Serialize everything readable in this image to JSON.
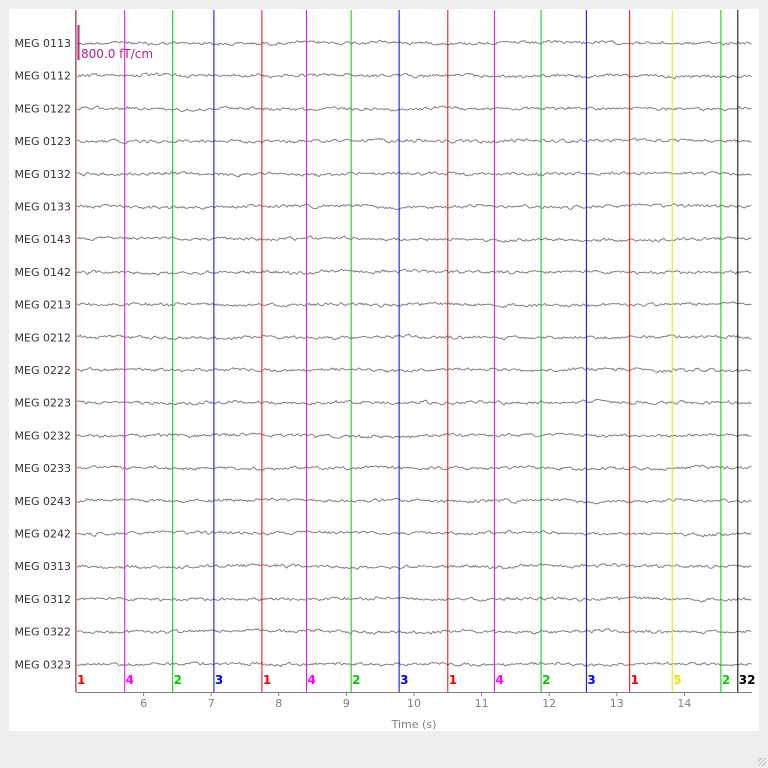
{
  "chart_data": {
    "type": "line",
    "xlabel": "Time (s)",
    "xlim": [
      5.0,
      15.0
    ],
    "x_ticks": [
      6,
      7,
      8,
      9,
      10,
      11,
      12,
      13,
      14
    ],
    "channels": [
      "MEG 0113",
      "MEG 0112",
      "MEG 0122",
      "MEG 0123",
      "MEG 0132",
      "MEG 0133",
      "MEG 0143",
      "MEG 0142",
      "MEG 0213",
      "MEG 0212",
      "MEG 0222",
      "MEG 0223",
      "MEG 0232",
      "MEG 0233",
      "MEG 0243",
      "MEG 0242",
      "MEG 0313",
      "MEG 0312",
      "MEG 0322",
      "MEG 0323"
    ],
    "trace_color": "#808080",
    "scale_bar": {
      "label": "800.0 fT/cm",
      "color": "#b5247e"
    },
    "events": [
      {
        "t": 5.0,
        "id": "1",
        "color": "#ff0000"
      },
      {
        "t": 5.72,
        "id": "4",
        "color": "#ff00ff"
      },
      {
        "t": 6.43,
        "id": "2",
        "color": "#00cc00"
      },
      {
        "t": 7.04,
        "id": "3",
        "color": "#0000ff"
      },
      {
        "t": 7.75,
        "id": "1",
        "color": "#ff0000"
      },
      {
        "t": 8.41,
        "id": "4",
        "color": "#ff00ff"
      },
      {
        "t": 9.07,
        "id": "2",
        "color": "#00cc00"
      },
      {
        "t": 9.78,
        "id": "3",
        "color": "#0000ff"
      },
      {
        "t": 10.5,
        "id": "1",
        "color": "#ff0000"
      },
      {
        "t": 11.19,
        "id": "4",
        "color": "#ff00ff"
      },
      {
        "t": 11.88,
        "id": "2",
        "color": "#00cc00"
      },
      {
        "t": 12.55,
        "id": "3",
        "color": "#0000ff"
      },
      {
        "t": 13.19,
        "id": "1",
        "color": "#ff0000"
      },
      {
        "t": 13.82,
        "id": "5",
        "color": "#e6e600"
      },
      {
        "t": 14.54,
        "id": "2",
        "color": "#00cc00"
      },
      {
        "t": 14.79,
        "id": "32",
        "color": "#000000"
      }
    ]
  }
}
